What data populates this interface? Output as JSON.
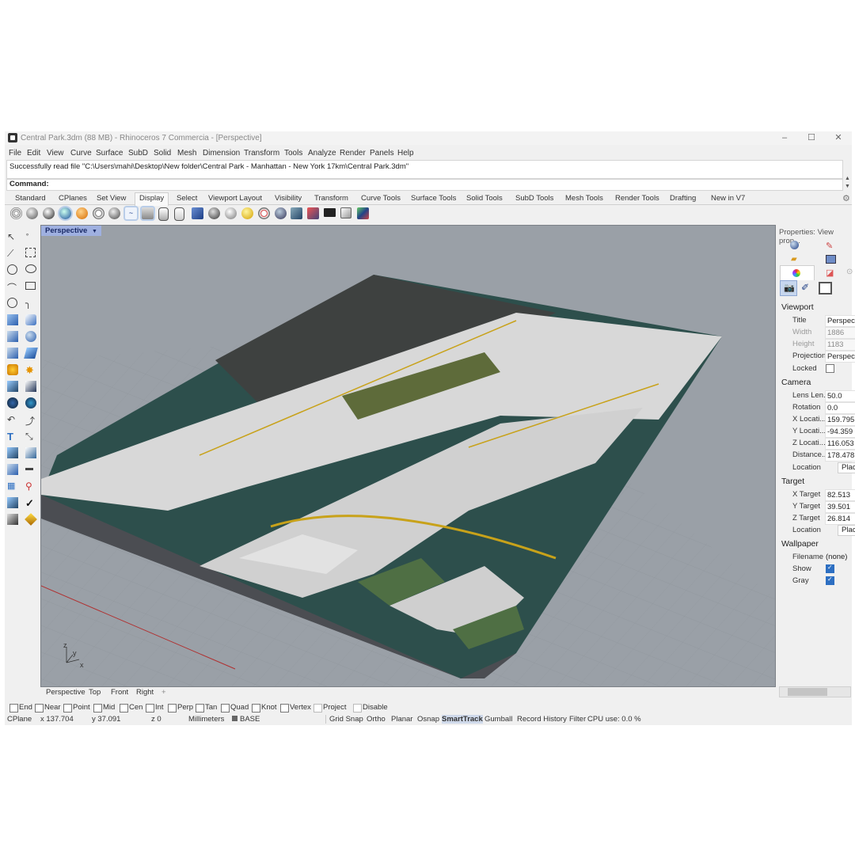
{
  "window": {
    "title": "Central Park.3dm (88 MB) - Rhinoceros 7 Commercia - [Perspective]",
    "minimize": "–",
    "maximize": "☐",
    "close": "✕"
  },
  "menu": [
    "File",
    "Edit",
    "View",
    "Curve",
    "Surface",
    "SubD",
    "Solid",
    "Mesh",
    "Dimension",
    "Transform",
    "Tools",
    "Analyze",
    "Render",
    "Panels",
    "Help"
  ],
  "command": {
    "history": "Successfully read file \"C:\\Users\\mahi\\Desktop\\New folder\\Central Park - Manhattan - New York 17km\\Central Park.3dm\"",
    "prompt": "Command:"
  },
  "tabs": [
    "Standard",
    "CPlanes",
    "Set View",
    "Display",
    "Select",
    "Viewport Layout",
    "Visibility",
    "Transform",
    "Curve Tools",
    "Surface Tools",
    "Solid Tools",
    "SubD Tools",
    "Mesh Tools",
    "Render Tools",
    "Drafting",
    "New in V7"
  ],
  "active_tab": "Display",
  "toolbar_icons": [
    "wireframe-icon",
    "shaded-icon",
    "rendered-icon",
    "ghosted-icon",
    "xray-icon",
    "technical-icon",
    "artistic-icon",
    "pen-icon",
    "arctic-icon",
    "raytraced-icon",
    "monochrome-icon",
    "mouse-icon",
    "silhouette-icon",
    "cplane-icon",
    "globe-icon",
    "sphere-icon",
    "light-icon",
    "target-icon",
    "camera-icon",
    "clip-icon",
    "monitor-icon",
    "box-icon",
    "layers-icon"
  ],
  "viewport": {
    "label": "Perspective",
    "tabs": [
      "Perspective",
      "Top",
      "Front",
      "Right"
    ],
    "add": "+",
    "axes": {
      "z": "z",
      "y": "y",
      "x": "x"
    }
  },
  "osnap": [
    {
      "label": "End",
      "checked": false
    },
    {
      "label": "Near",
      "checked": false
    },
    {
      "label": "Point",
      "checked": false
    },
    {
      "label": "Mid",
      "checked": false
    },
    {
      "label": "Cen",
      "checked": false
    },
    {
      "label": "Int",
      "checked": false
    },
    {
      "label": "Perp",
      "checked": false
    },
    {
      "label": "Tan",
      "checked": false
    },
    {
      "label": "Quad",
      "checked": false
    },
    {
      "label": "Knot",
      "checked": false
    },
    {
      "label": "Vertex",
      "checked": false
    },
    {
      "label": "Project",
      "checked": false
    },
    {
      "label": "Disable",
      "checked": false
    }
  ],
  "status": {
    "cplane": "CPlane",
    "x": "x 137.704",
    "y": "y 37.091",
    "z": "z 0",
    "units": "Millimeters",
    "layer": "BASE",
    "layer_color": "#666666",
    "grid_snap": "Grid Snap",
    "ortho": "Ortho",
    "planar": "Planar",
    "osnap": "Osnap",
    "smarttrack": "SmartTrack",
    "gumball": "Gumball",
    "record_history": "Record History",
    "filter": "Filter",
    "cpu": "CPU use: 0.0 %"
  },
  "panel": {
    "title": "Properties: View prop...",
    "viewport_section": "Viewport",
    "viewport": [
      {
        "label": "Title",
        "value": "Perspect"
      },
      {
        "label": "Width",
        "value": "1886"
      },
      {
        "label": "Height",
        "value": "1183"
      },
      {
        "label": "Projection",
        "value": "Perspect"
      }
    ],
    "locked_label": "Locked",
    "camera_section": "Camera",
    "camera": [
      {
        "label": "Lens Len...",
        "value": "50.0"
      },
      {
        "label": "Rotation",
        "value": "0.0"
      },
      {
        "label": "X Locati...",
        "value": "159.795"
      },
      {
        "label": "Y Locati...",
        "value": "-94.359"
      },
      {
        "label": "Z Locati...",
        "value": "116.053"
      },
      {
        "label": "Distance...",
        "value": "178.478"
      }
    ],
    "location_label": "Location",
    "place_button": "Place",
    "target_section": "Target",
    "target": [
      {
        "label": "X Target",
        "value": "82.513"
      },
      {
        "label": "Y Target",
        "value": "39.501"
      },
      {
        "label": "Z Target",
        "value": "26.814"
      }
    ],
    "wallpaper_section": "Wallpaper",
    "filename_label": "Filename",
    "filename_value": "(none)",
    "show_label": "Show",
    "gray_label": "Gray"
  }
}
